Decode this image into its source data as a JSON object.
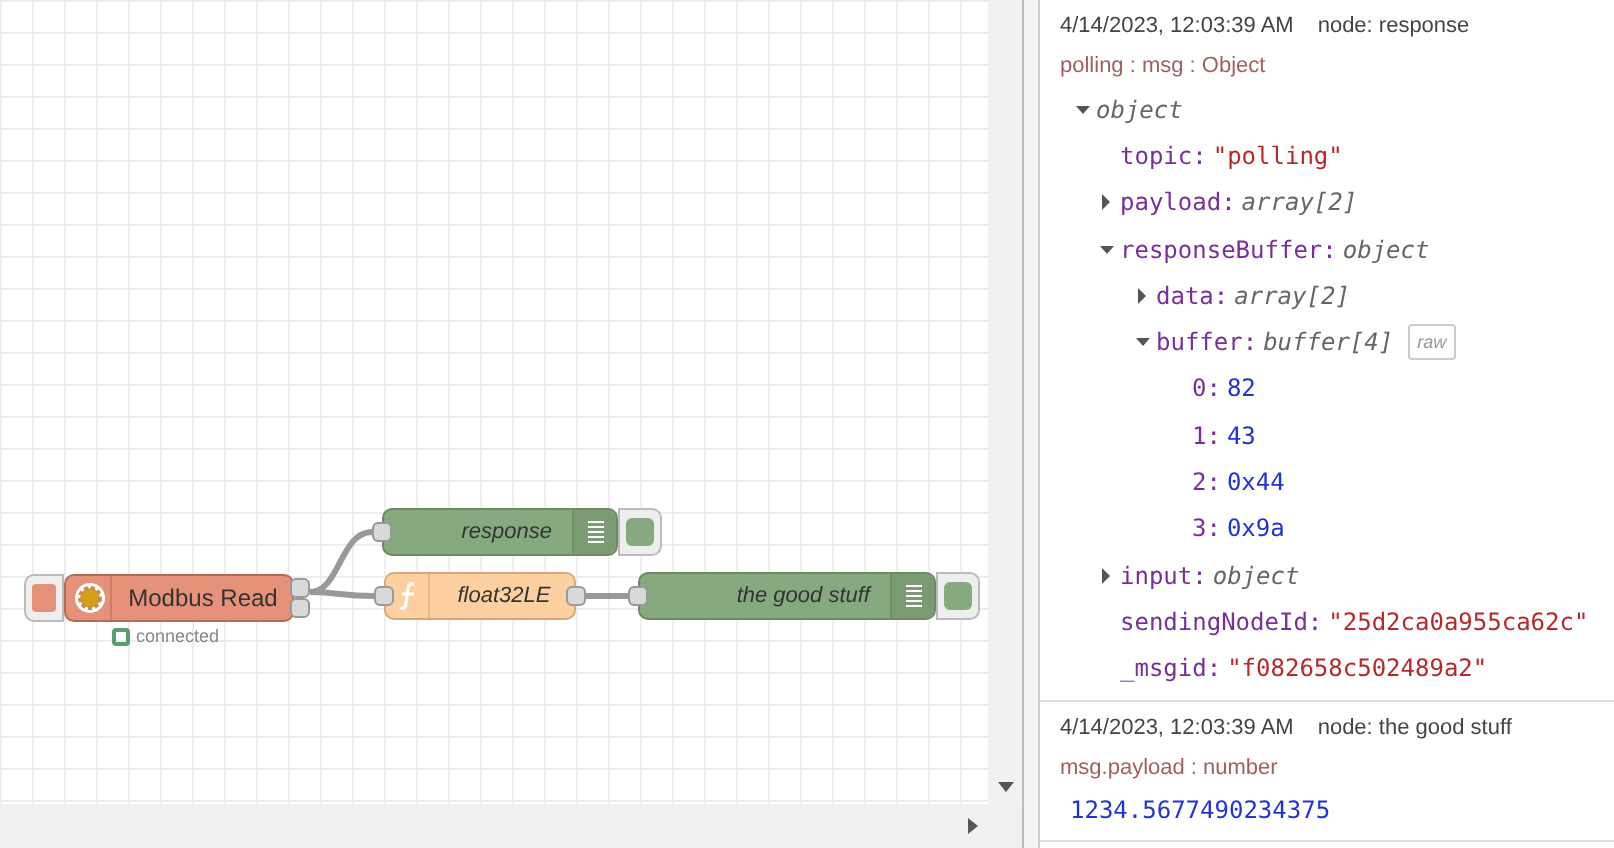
{
  "flow_canvas": {
    "nodes": [
      {
        "kind": "modbus",
        "label": "Modbus Read",
        "status": {
          "text": "connected",
          "color": "#5a9e6f"
        }
      },
      {
        "kind": "debug",
        "label": "response"
      },
      {
        "kind": "function",
        "label": "float32LE"
      },
      {
        "kind": "debug",
        "label": "the good stuff"
      }
    ]
  },
  "debug_panel": {
    "messages": [
      {
        "timestamp": "4/14/2023, 12:03:39 AM",
        "node": "node: response",
        "meta": "polling : msg : Object",
        "tree": {
          "label": "object",
          "expanded": true,
          "children": [
            {
              "key": "topic:",
              "value": "\"polling\"",
              "kind": "string"
            },
            {
              "key": "payload:",
              "value": "array[2]",
              "kind": "type",
              "expanded": false
            },
            {
              "key": "responseBuffer:",
              "value": "object",
              "kind": "type",
              "expanded": true,
              "children": [
                {
                  "key": "data:",
                  "value": "array[2]",
                  "kind": "type",
                  "expanded": false
                },
                {
                  "key": "buffer:",
                  "value": "buffer[4]",
                  "kind": "type",
                  "expanded": true,
                  "badge": "raw",
                  "children": [
                    {
                      "key": "0:",
                      "value": "82",
                      "kind": "number"
                    },
                    {
                      "key": "1:",
                      "value": "43",
                      "kind": "number"
                    },
                    {
                      "key": "2:",
                      "value": "0x44",
                      "kind": "number"
                    },
                    {
                      "key": "3:",
                      "value": "0x9a",
                      "kind": "number"
                    }
                  ]
                }
              ]
            },
            {
              "key": "input:",
              "value": "object",
              "kind": "type",
              "expanded": false
            },
            {
              "key": "sendingNodeId:",
              "value": "\"25d2ca0a955ca62c\"",
              "kind": "string"
            },
            {
              "key": "_msgid:",
              "value": "\"f082658c502489a2\"",
              "kind": "string"
            }
          ]
        }
      },
      {
        "timestamp": "4/14/2023, 12:03:39 AM",
        "node": "node: the good stuff",
        "meta": "msg.payload : number",
        "value": "1234.5677490234375"
      }
    ]
  }
}
